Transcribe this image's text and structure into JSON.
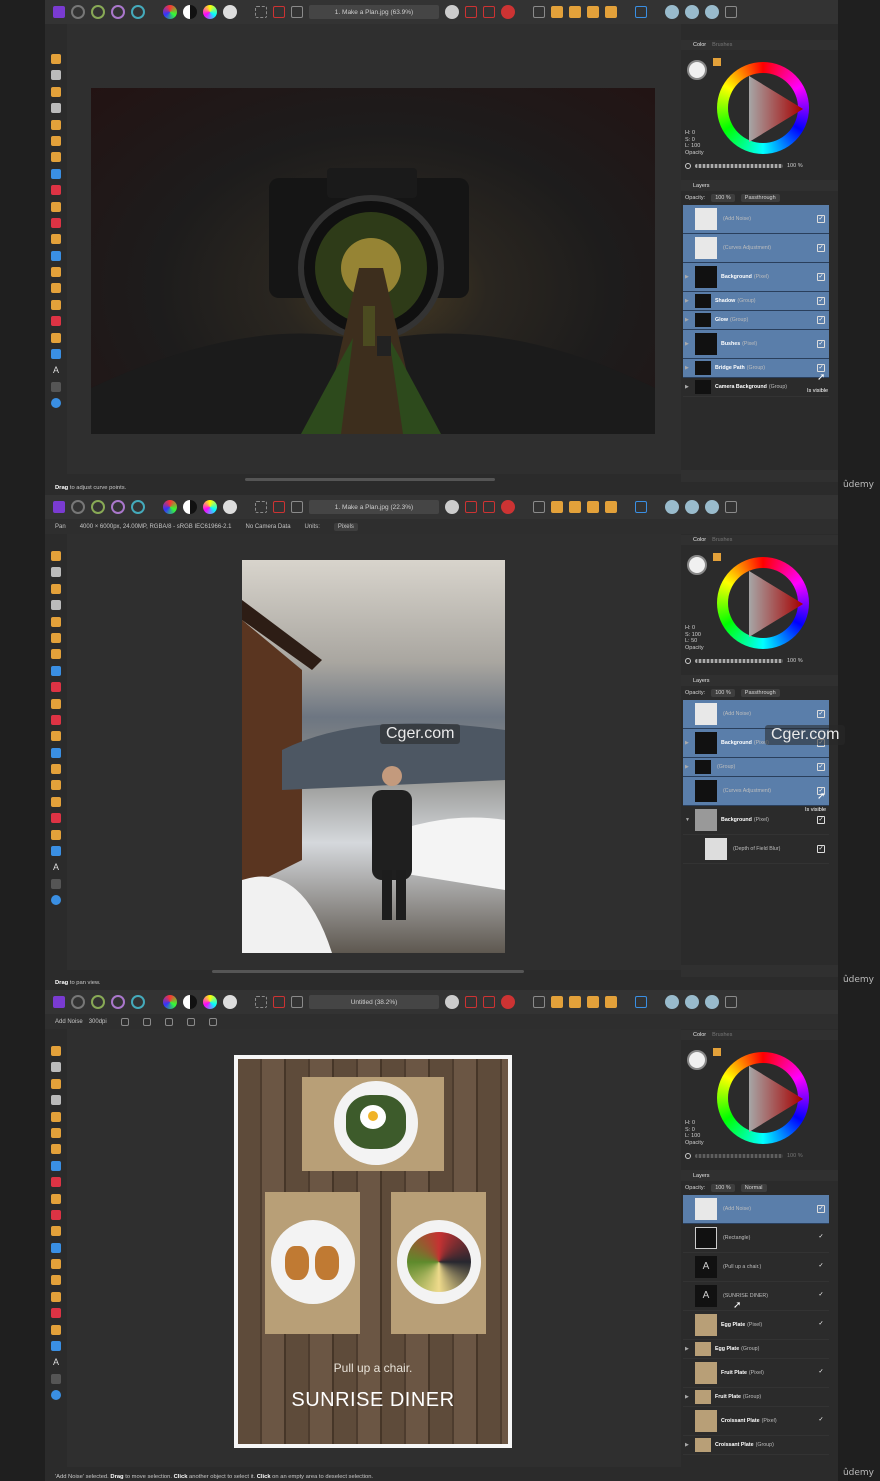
{
  "watermark": "Cger.com",
  "brand": "ûdemy",
  "colors": {
    "accent": "#5a7eaa",
    "app_bg": "#2b2b2b",
    "canvas_bg": "#2f2f2f"
  },
  "s1": {
    "doc_title": "1. Make a Plan.jpg (63.9%)",
    "status_bold": "Drag",
    "status_rest": " to adjust curve points.",
    "color_tabs": [
      "Color",
      "Brushes"
    ],
    "hsl": [
      "H: 0",
      "S: 0",
      "L: 100"
    ],
    "opacity_label": "Opacity",
    "opacity_value": "100 %",
    "layers_title": "Layers",
    "opts": {
      "opacity_label": "Opacity:",
      "opacity": "100 %",
      "blend": "Passthrough"
    },
    "layers": [
      {
        "name": "",
        "sub": "(Add Noise)"
      },
      {
        "name": "",
        "sub": "(Curves Adjustment)"
      },
      {
        "name": "Background",
        "sub": "(Pixel)"
      },
      {
        "name": "Shadow",
        "sub": "(Group)"
      },
      {
        "name": "Glow",
        "sub": "(Group)"
      },
      {
        "name": "Bushes",
        "sub": "(Pixel)"
      },
      {
        "name": "Bridge Path",
        "sub": "(Group)"
      },
      {
        "name": "Camera Background",
        "sub": "(Group)"
      }
    ],
    "tooltip": "Is visible"
  },
  "s2": {
    "doc_title": "1. Make a Plan.jpg (22.3%)",
    "ctx": [
      "Pan",
      "4000 × 6000px, 24.00MP, RGBA/8 - sRGB IEC61966-2.1",
      "No Camera Data",
      "Units:",
      "Pixels"
    ],
    "status_bold": "Drag",
    "status_rest": " to pan view.",
    "color_tabs": [
      "Color",
      "Brushes"
    ],
    "hsl": [
      "H: 0",
      "S: 100",
      "L: 50"
    ],
    "opacity_label": "Opacity",
    "opacity_value": "100 %",
    "layers_title": "Layers",
    "opts": {
      "opacity_label": "Opacity:",
      "opacity": "100 %",
      "blend": "Passthrough"
    },
    "layers": [
      {
        "name": "",
        "sub": "(Add Noise)"
      },
      {
        "name": "Background",
        "sub": "(Pixel)"
      },
      {
        "name": "",
        "sub": "(Group)"
      },
      {
        "name": "",
        "sub": "(Curves Adjustment)"
      },
      {
        "name": "Background",
        "sub": "(Pixel)"
      },
      {
        "name": "",
        "sub": "(Depth of Field Blur)"
      }
    ],
    "tooltip": "Is visible"
  },
  "s3": {
    "doc_title": "Untitled (38.2%)",
    "ctx": [
      "Add Noise",
      "300dpi"
    ],
    "poster_line1": "Pull up a chair.",
    "poster_line2": "SUNRISE DINER",
    "status": [
      "'Add Noise' selected. ",
      "Drag",
      " to move selection. ",
      "Click",
      " another object to select it. ",
      "Click",
      " on an empty area to deselect selection."
    ],
    "color_tabs": [
      "Color",
      "Brushes"
    ],
    "hsl": [
      "H: 0",
      "S: 0",
      "L: 100"
    ],
    "opacity_label": "Opacity",
    "opacity_value": "100 %",
    "layers_title": "Layers",
    "opts": {
      "opacity_label": "Opacity:",
      "opacity": "100 %",
      "blend": "Normal"
    },
    "layers": [
      {
        "name": "",
        "sub": "(Add Noise)"
      },
      {
        "name": "",
        "sub": "(Rectangle)"
      },
      {
        "name": "",
        "sub": "(Pull up a chair.)"
      },
      {
        "name": "",
        "sub": "(SUNRISE DINER)"
      },
      {
        "name": "Egg Plate",
        "sub": "(Pixel)"
      },
      {
        "name": "Egg Plate",
        "sub": "(Group)"
      },
      {
        "name": "Fruit Plate",
        "sub": "(Pixel)"
      },
      {
        "name": "Fruit Plate",
        "sub": "(Group)"
      },
      {
        "name": "Croissant Plate",
        "sub": "(Pixel)"
      },
      {
        "name": "Croissant Plate",
        "sub": "(Group)"
      }
    ]
  }
}
